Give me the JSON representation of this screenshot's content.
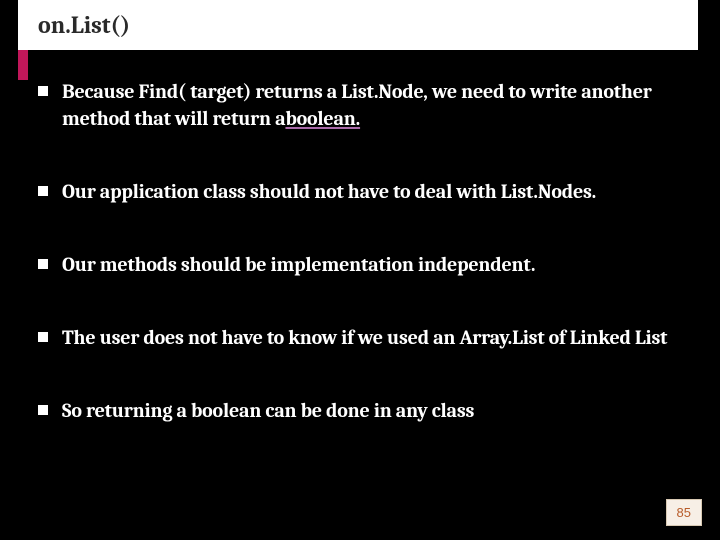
{
  "title": "on.List()",
  "bullets": [
    {
      "pre": "Because Find( target) returns a List.Node, we need to write another method that will return a",
      "em": "boolean."
    },
    {
      "pre": "Our application class should not have to deal with List.Nodes."
    },
    {
      "pre": "Our methods should be implementation independent."
    },
    {
      "pre": "The user does not have to know if we used an Array.List of Linked List"
    },
    {
      "pre": "So returning a boolean can be done in any class"
    }
  ],
  "page_number": "85"
}
